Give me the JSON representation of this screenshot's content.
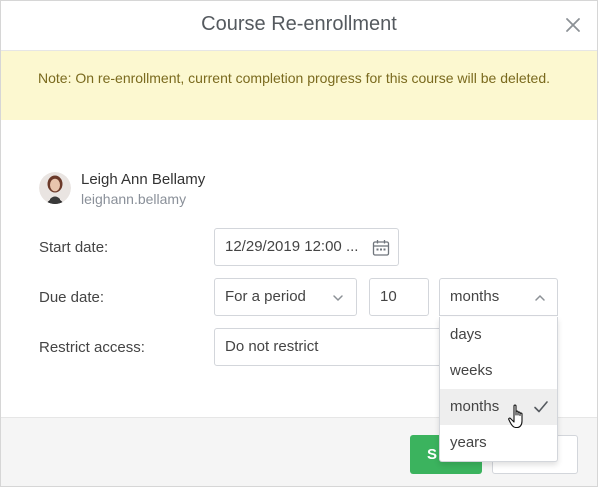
{
  "dialog": {
    "title": "Course Re-enrollment",
    "close_icon": "close-icon"
  },
  "notice": {
    "text": "Note: On re-enrollment, current completion progress for this course will be deleted."
  },
  "user": {
    "name": "Leigh Ann Bellamy",
    "login": "leighann.bellamy"
  },
  "form": {
    "start_date": {
      "label": "Start date:",
      "value": "12/29/2019 12:00 ...",
      "icon": "calendar-icon"
    },
    "due_date": {
      "label": "Due date:",
      "type_value": "For a period",
      "amount": "10",
      "unit_value": "months",
      "unit_options": [
        "days",
        "weeks",
        "months",
        "years"
      ],
      "selected_option": "months"
    },
    "restrict_access": {
      "label": "Restrict access:",
      "value": "Do not restrict"
    }
  },
  "footer": {
    "save_label": "S"
  },
  "colors": {
    "notice_bg": "#fcf8d0",
    "notice_text": "#7a6a1e",
    "save_button": "#3bb35e"
  }
}
